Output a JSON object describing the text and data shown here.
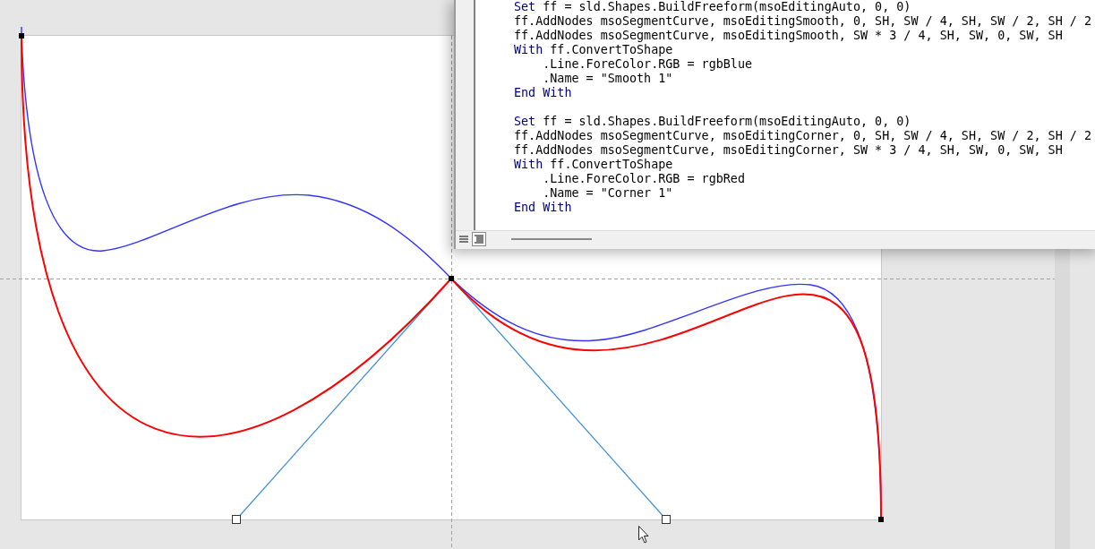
{
  "slide": {
    "shapes": [
      {
        "kind": "smooth",
        "color": "#3333ff"
      },
      {
        "kind": "corner",
        "color": "#ff0000"
      }
    ]
  },
  "code_window": {
    "blocks": [
      [
        {
          "keyword": "Set",
          "text": " ff = sld.Shapes.BuildFreeform(msoEditingAuto, 0, 0)"
        },
        {
          "text": "ff.AddNodes msoSegmentCurve, msoEditingSmooth, 0, SH, SW / 4, SH, SW / 2, SH / 2"
        },
        {
          "text": "ff.AddNodes msoSegmentCurve, msoEditingSmooth, SW * 3 / 4, SH, SW, 0, SW, SH"
        },
        {
          "keyword": "With",
          "text": " ff.ConvertToShape"
        },
        {
          "text": "    .Line.ForeColor.RGB = rgbBlue"
        },
        {
          "text": "    .Name = \"Smooth 1\""
        },
        {
          "keyword": "End With"
        }
      ],
      [
        {
          "keyword": "Set",
          "text": " ff = sld.Shapes.BuildFreeform(msoEditingAuto, 0, 0)"
        },
        {
          "text": "ff.AddNodes msoSegmentCurve, msoEditingCorner, 0, SH, SW / 4, SH, SW / 2, SH / 2"
        },
        {
          "text": "ff.AddNodes msoSegmentCurve, msoEditingCorner, SW * 3 / 4, SH, SW, 0, SW, SH"
        },
        {
          "keyword": "With",
          "text": " ff.ConvertToShape"
        },
        {
          "text": "    .Line.ForeColor.RGB = rgbRed"
        },
        {
          "text": "    .Name = \"Corner 1\""
        },
        {
          "keyword": "End With"
        }
      ]
    ]
  }
}
